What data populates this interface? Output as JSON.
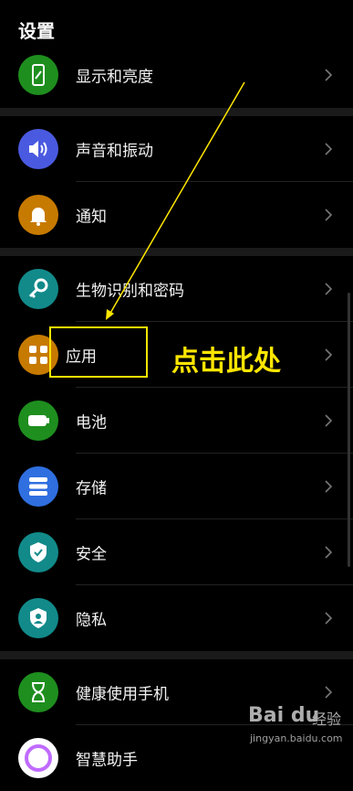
{
  "header": {
    "title": "设置"
  },
  "items": [
    {
      "label": "显示和亮度",
      "icon": "phone-display-icon",
      "color": "#1e8e1e"
    },
    {
      "label": "声音和振动",
      "icon": "speaker-icon",
      "color": "#4a5ae0"
    },
    {
      "label": "通知",
      "icon": "bell-icon",
      "color": "#c77a00"
    },
    {
      "label": "生物识别和密码",
      "icon": "key-icon",
      "color": "#128a8a"
    },
    {
      "label": "应用",
      "icon": "apps-grid-icon",
      "color": "#c77a00"
    },
    {
      "label": "电池",
      "icon": "battery-icon",
      "color": "#1e8e1e"
    },
    {
      "label": "存储",
      "icon": "storage-icon",
      "color": "#2f6fe0"
    },
    {
      "label": "安全",
      "icon": "shield-check-icon",
      "color": "#128a8a"
    },
    {
      "label": "隐私",
      "icon": "privacy-shield-icon",
      "color": "#128a8a"
    },
    {
      "label": "健康使用手机",
      "icon": "hourglass-icon",
      "color": "#1e8e1e"
    },
    {
      "label": "智慧助手",
      "icon": "assistant-icon",
      "color": "#ffffff"
    }
  ],
  "annotation": {
    "text": "点击此处",
    "color": "#ffe600"
  },
  "watermark": {
    "logo": "Bai du",
    "name": "经验",
    "url": "jingyan.baidu.com"
  }
}
